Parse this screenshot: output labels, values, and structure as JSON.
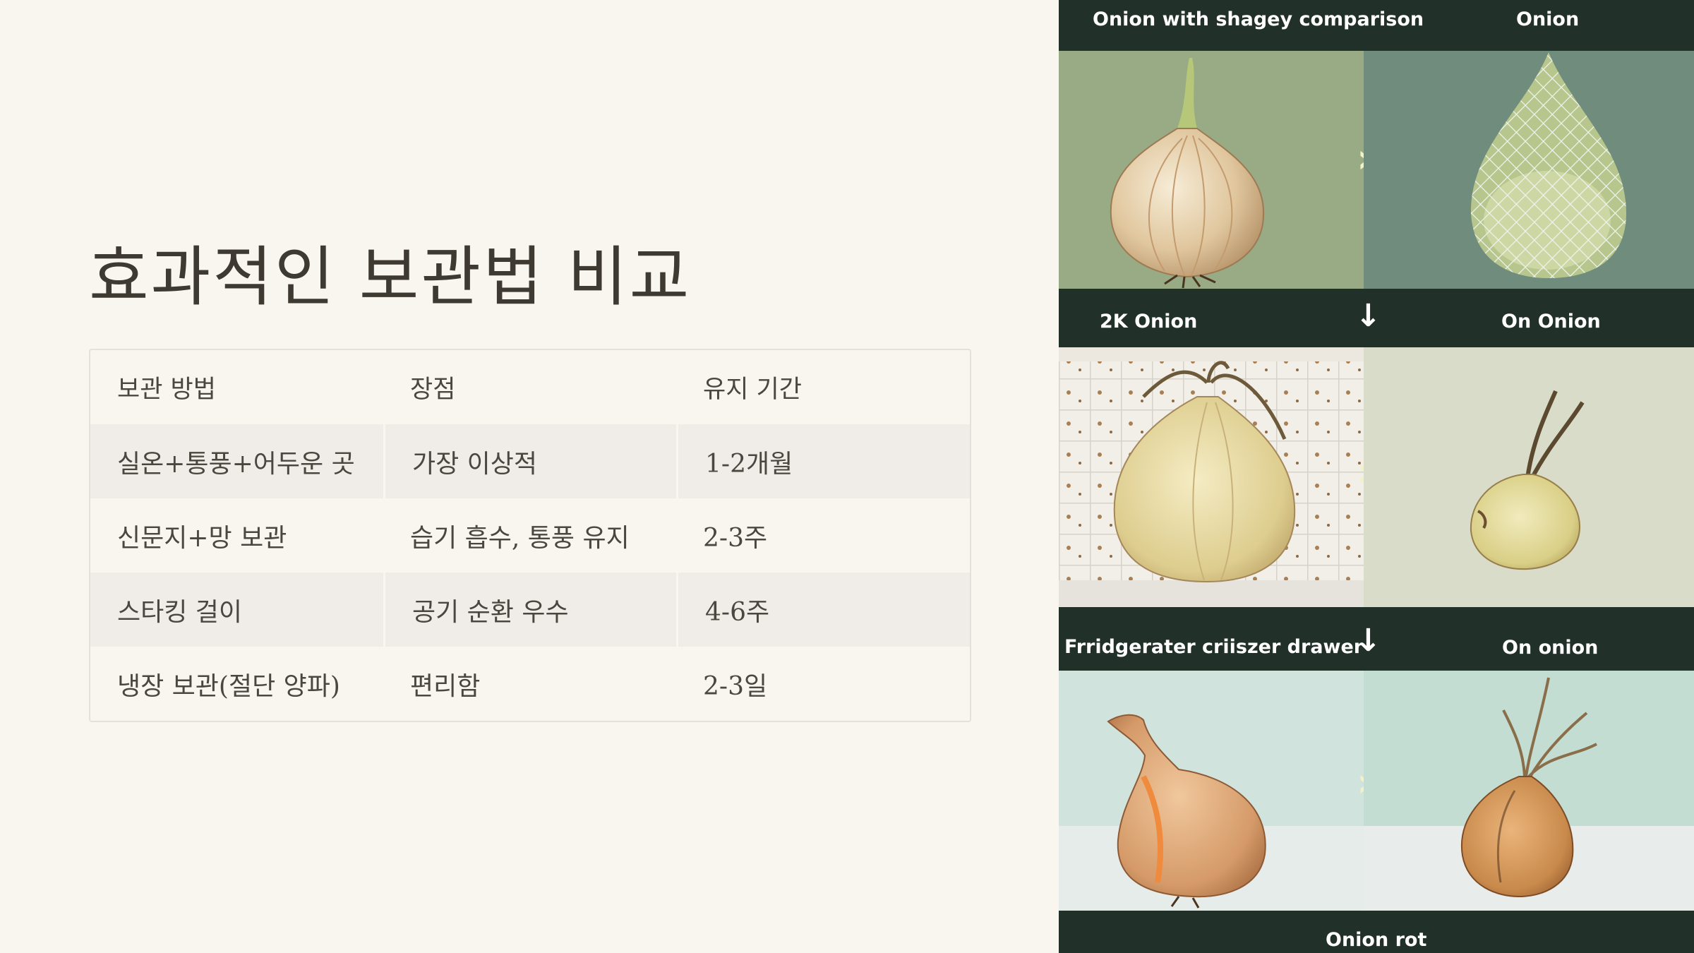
{
  "slide": {
    "title": "효과적인 보관법 비교"
  },
  "table": {
    "headers": [
      "보관 방법",
      "장점",
      "유지 기간"
    ],
    "rows": [
      [
        "실온+통풍+어두운 곳",
        "가장 이상적",
        "1-2개월"
      ],
      [
        "신문지+망 보관",
        "습기 흡수, 통풍 유지",
        "2-3주"
      ],
      [
        "스타킹 걸이",
        "공기 순환 우수",
        "4-6주"
      ],
      [
        "냉장 보관(절단 양파)",
        "편리함",
        "2-3일"
      ]
    ]
  },
  "image": {
    "labels": {
      "top_left": "Onion with shagey comparison",
      "top_right": "Onion",
      "mid_left": "2K Onion",
      "mid_right": "On Onion",
      "low_left": "Frridgerater criiszer drawer",
      "low_right": "On onion",
      "bottom": "Onion rot"
    },
    "arrows": {
      "right": "›",
      "down": "↓"
    },
    "panels": [
      "whole-onion",
      "onion-in-mesh-net",
      "sprouting-onion-in-drawer",
      "small-sprouting-onion",
      "split-onion",
      "rotting-onion"
    ],
    "colors": {
      "band": "#22302a",
      "panel1": "#98ab84",
      "panel2": "#6f8c7c",
      "panel3": "#ece8e0",
      "panel4": "#d8dcc8",
      "panel5": "#d0e3dc",
      "panel6": "#c3ddd3"
    }
  }
}
